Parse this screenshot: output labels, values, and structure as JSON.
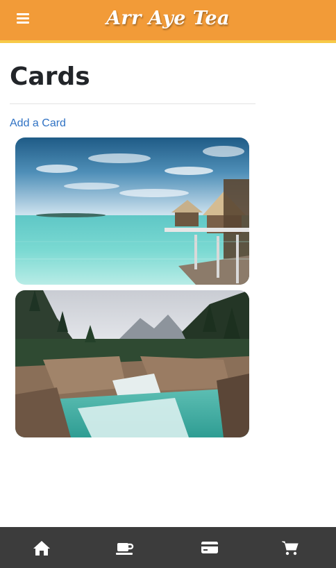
{
  "header": {
    "brand": "Arr Aye Tea",
    "menu_icon": "hamburger-menu-icon",
    "accent_color": "#f29b38",
    "underline_color": "#f7c948"
  },
  "main": {
    "title": "Cards",
    "add_link": "Add a Card",
    "link_color": "#2f72c4",
    "cards": [
      {
        "image": "tropical-overwater-bungalows-image"
      },
      {
        "image": "mountain-river-canyon-image"
      }
    ]
  },
  "bottom_nav": {
    "background": "#3c3c3c",
    "items": [
      {
        "icon": "home-icon"
      },
      {
        "icon": "tea-cup-icon"
      },
      {
        "icon": "credit-card-icon"
      },
      {
        "icon": "cart-icon"
      }
    ]
  }
}
